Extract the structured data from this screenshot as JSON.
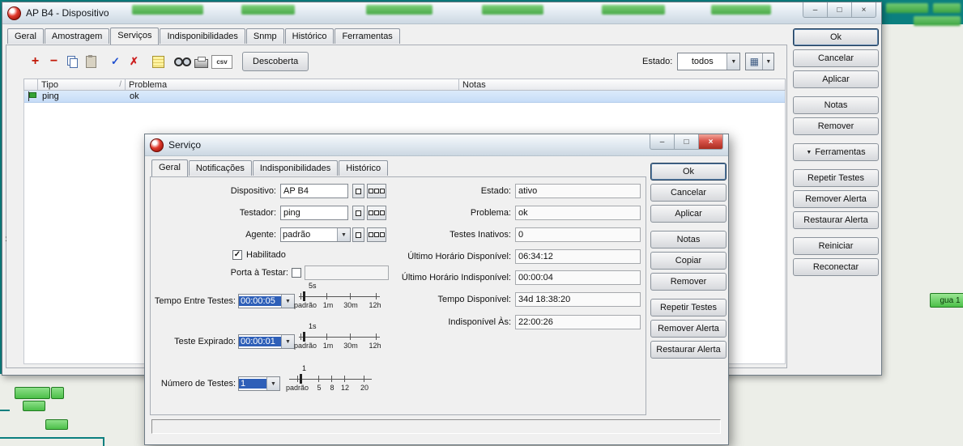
{
  "chrome": {
    "minimize": "–",
    "maximize": "□",
    "close": "×",
    "dropdown": "▼",
    "grid": "▦",
    "sort": "/"
  },
  "desktop": {
    "map_label": "gua 1",
    "stray_mark": ":"
  },
  "main_window": {
    "title": "AP B4 - Dispositivo",
    "tabs": [
      "Geral",
      "Amostragem",
      "Serviços",
      "Indisponibilidades",
      "Snmp",
      "Histórico",
      "Ferramentas"
    ],
    "active_tab": "Serviços",
    "toolbar": {
      "add": "+",
      "remove": "−",
      "ack": "✓",
      "unack": "✗",
      "csv": "csv",
      "discover": "Descoberta",
      "estado_label": "Estado:",
      "estado_value": "todos"
    },
    "table": {
      "headers": [
        "Tipo",
        "Problema",
        "Notas"
      ],
      "rows": [
        {
          "tipo": "ping",
          "problema": "ok",
          "notas": ""
        }
      ]
    },
    "buttons": [
      "Ok",
      "Cancelar",
      "Aplicar",
      "Notas",
      "Remover",
      "Ferramentas",
      "Repetir Testes",
      "Remover Alerta",
      "Restaurar Alerta",
      "Reiniciar",
      "Reconectar"
    ]
  },
  "dialog": {
    "title": "Serviço",
    "tabs": [
      "Geral",
      "Notificações",
      "Indisponibilidades",
      "Histórico"
    ],
    "active_tab": "Geral",
    "left": {
      "dispositivo_label": "Dispositivo:",
      "dispositivo_value": "AP B4",
      "testador_label": "Testador:",
      "testador_value": "ping",
      "agente_label": "Agente:",
      "agente_value": "padrão",
      "habilitado_label": "Habilitado",
      "habilitado_checked": true,
      "porta_label": "Porta à Testar:",
      "porta_checked": false,
      "porta_value": "",
      "tempo_label": "Tempo Entre Testes:",
      "tempo_value": "00:00:05",
      "tempo_slider": "5s",
      "tempo_ticks": [
        "padrão",
        "1m",
        "30m",
        "12h"
      ],
      "expirado_label": "Teste Expirado:",
      "expirado_value": "00:00:01",
      "expirado_slider": "1s",
      "expirado_ticks": [
        "padrão",
        "1m",
        "30m",
        "12h"
      ],
      "numero_label": "Número de Testes:",
      "numero_value": "1",
      "numero_slider": "1",
      "numero_ticks": [
        "padrão",
        "5",
        "8",
        "12",
        "20"
      ]
    },
    "right": [
      {
        "label": "Estado:",
        "value": "ativo"
      },
      {
        "label": "Problema:",
        "value": "ok"
      },
      {
        "label": "Testes Inativos:",
        "value": "0"
      },
      {
        "label": "Último Horário Disponível:",
        "value": "06:34:12"
      },
      {
        "label": "Último Horário Indisponível:",
        "value": "00:00:04"
      },
      {
        "label": "Tempo Disponível:",
        "value": "34d 18:38:20"
      },
      {
        "label": "Indisponível Às:",
        "value": "22:00:26"
      }
    ],
    "buttons": [
      "Ok",
      "Cancelar",
      "Aplicar",
      "Notas",
      "Copiar",
      "Remover",
      "Repetir Testes",
      "Remover Alerta",
      "Restaurar Alerta"
    ]
  }
}
